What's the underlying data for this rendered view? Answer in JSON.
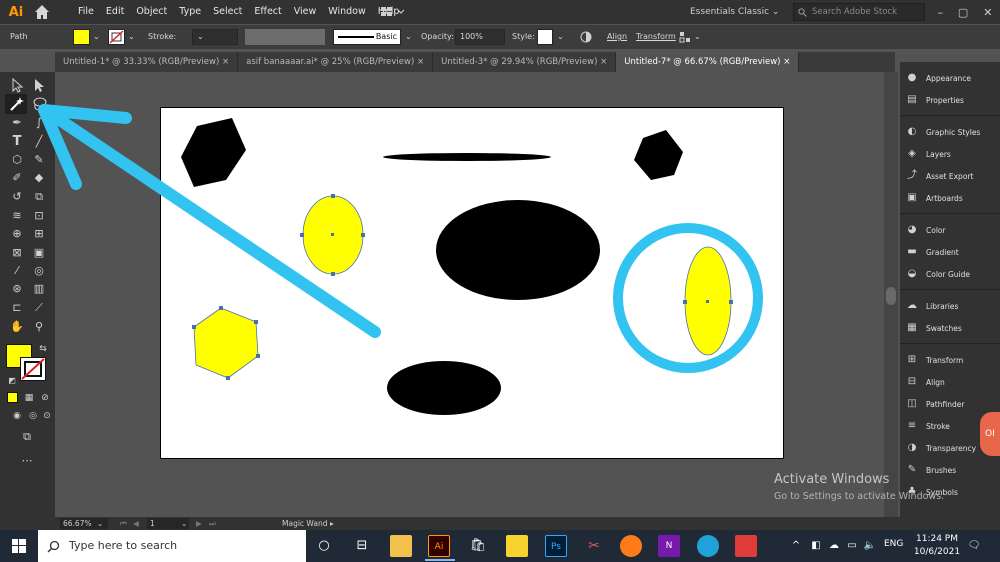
{
  "app": {
    "logo": "Ai",
    "menu": [
      "File",
      "Edit",
      "Object",
      "Type",
      "Select",
      "Effect",
      "View",
      "Window",
      "Help"
    ],
    "workspace": "Essentials Classic",
    "search_placeholder": "Search Adobe Stock"
  },
  "control_bar": {
    "selection_type": "Path",
    "stroke_label": "Stroke:",
    "brush_label": "Basic",
    "opacity_label": "Opacity:",
    "opacity_value": "100%",
    "style_label": "Style:",
    "align_label": "Align",
    "transform_label": "Transform"
  },
  "tabs": [
    {
      "label": "Untitled-1* @ 33.33% (RGB/Preview)",
      "active": false
    },
    {
      "label": "asif banaaaar.ai* @ 25% (RGB/Preview)",
      "active": false
    },
    {
      "label": "Untitled-3* @ 29.94% (RGB/Preview)",
      "active": false
    },
    {
      "label": "Untitled-7* @ 66.67% (RGB/Preview)",
      "active": true
    }
  ],
  "colors": {
    "fill": "#ffff00",
    "annotation": "#33c3f0",
    "canvas": "#535353"
  },
  "panels": [
    "Appearance",
    "Properties",
    "Graphic Styles",
    "Layers",
    "Asset Export",
    "Artboards",
    "Color",
    "Gradient",
    "Color Guide",
    "Libraries",
    "Swatches",
    "Transform",
    "Align",
    "Pathfinder",
    "Stroke",
    "Transparency",
    "Brushes",
    "Symbols"
  ],
  "panel_icons": [
    "appearance-icon",
    "properties-icon",
    "graphic-styles-icon",
    "layers-icon",
    "asset-export-icon",
    "artboards-icon",
    "color-icon",
    "gradient-icon",
    "color-guide-icon",
    "libraries-icon",
    "swatches-icon",
    "transform-icon",
    "align-icon",
    "pathfinder-icon",
    "stroke-icon",
    "transparency-icon",
    "brushes-icon",
    "symbols-icon"
  ],
  "status_bar": {
    "zoom": "66.67%",
    "artboard_num": "1",
    "current_tool": "Magic Wand"
  },
  "watermark": {
    "line1": "Activate Windows",
    "line2": "Go to Settings to activate Windows."
  },
  "side_badge": "OI",
  "taskbar": {
    "search_placeholder": "Type here to search",
    "ai_label": "Ai",
    "ps_label": "Ps",
    "n_label": "N",
    "lang": "ENG",
    "time": "11:24 PM",
    "date": "10/6/2021"
  }
}
